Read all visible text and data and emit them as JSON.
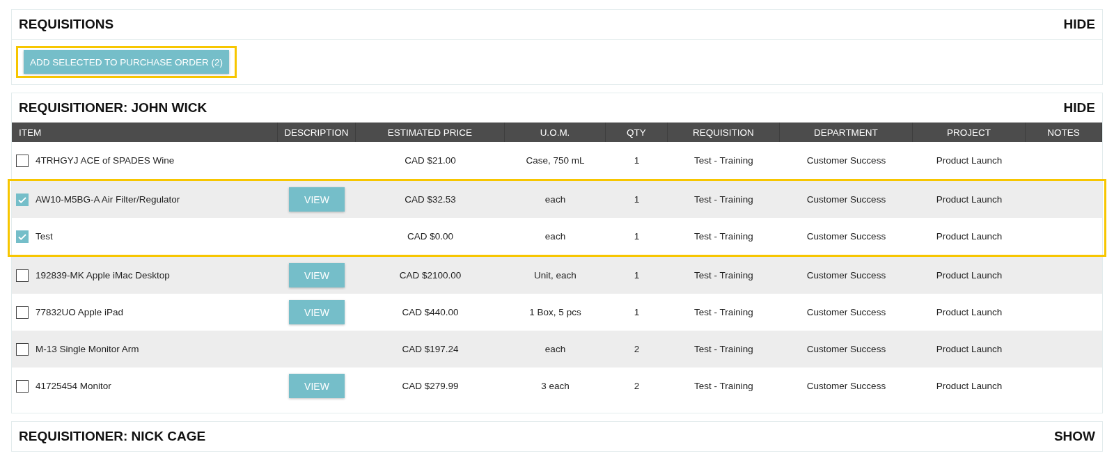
{
  "requisitions_panel": {
    "title": "REQUISITIONS",
    "toggle": "HIDE",
    "add_button": {
      "label": "ADD SELECTED TO PURCHASE ORDER (2)",
      "highlighted": true
    }
  },
  "requisitioner_panels": [
    {
      "title": "REQUISITIONER: JOHN WICK",
      "toggle": "HIDE",
      "table": {
        "columns": [
          "ITEM",
          "DESCRIPTION",
          "ESTIMATED PRICE",
          "U.O.M.",
          "QTY",
          "REQUISITION",
          "DEPARTMENT",
          "PROJECT",
          "NOTES"
        ],
        "rows": [
          {
            "checked": false,
            "highlighted": false,
            "item": "4TRHGYJ ACE of SPADES Wine",
            "description": "",
            "price": "CAD $21.00",
            "uom": "Case, 750 mL",
            "qty": "1",
            "requisition": "Test - Training",
            "department": "Customer Success",
            "project": "Product Launch"
          },
          {
            "checked": true,
            "highlighted": true,
            "item": "AW10-M5BG-A Air Filter/Regulator",
            "description": "VIEW",
            "price": "CAD $32.53",
            "uom": "each",
            "qty": "1",
            "requisition": "Test - Training",
            "department": "Customer Success",
            "project": "Product Launch"
          },
          {
            "checked": true,
            "highlighted": true,
            "item": "Test",
            "description": "",
            "price": "CAD $0.00",
            "uom": "each",
            "qty": "1",
            "requisition": "Test - Training",
            "department": "Customer Success",
            "project": "Product Launch"
          },
          {
            "checked": false,
            "highlighted": false,
            "item": "192839-MK Apple iMac Desktop",
            "description": "VIEW",
            "price": "CAD $2100.00",
            "uom": "Unit, each",
            "qty": "1",
            "requisition": "Test - Training",
            "department": "Customer Success",
            "project": "Product Launch"
          },
          {
            "checked": false,
            "highlighted": false,
            "item": "77832UO Apple iPad",
            "description": "VIEW",
            "price": "CAD $440.00",
            "uom": "1 Box, 5 pcs",
            "qty": "1",
            "requisition": "Test - Training",
            "department": "Customer Success",
            "project": "Product Launch"
          },
          {
            "checked": false,
            "highlighted": false,
            "item": "M-13 Single Monitor Arm",
            "description": "",
            "price": "CAD $197.24",
            "uom": "each",
            "qty": "2",
            "requisition": "Test - Training",
            "department": "Customer Success",
            "project": "Product Launch"
          },
          {
            "checked": false,
            "highlighted": false,
            "item": "41725454 Monitor",
            "description": "VIEW",
            "price": "CAD $279.99",
            "uom": "3 each",
            "qty": "2",
            "requisition": "Test - Training",
            "department": "Customer Success",
            "project": "Product Launch"
          }
        ]
      }
    },
    {
      "title": "REQUISITIONER: NICK CAGE",
      "toggle": "SHOW"
    }
  ]
}
